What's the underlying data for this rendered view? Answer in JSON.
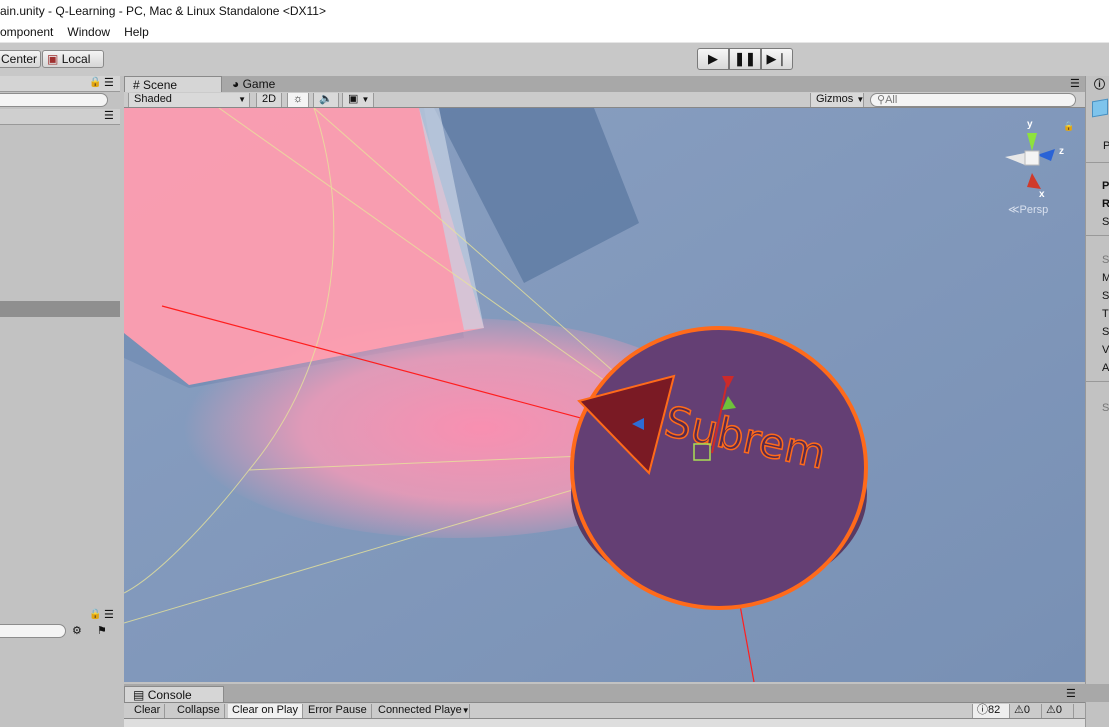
{
  "window": {
    "title": "ain.unity - Q-Learning - PC, Mac & Linux Standalone <DX11>"
  },
  "menu": [
    "omponent",
    "Window",
    "Help"
  ],
  "toolbar": {
    "pivot_label": "Center",
    "space_label": "Local",
    "play_icons": [
      "play-icon",
      "pause-icon",
      "step-icon"
    ]
  },
  "scene": {
    "tabs": [
      "Scene",
      "Game"
    ],
    "shading": "Shaded",
    "mode_2d": "2D",
    "gizmos": "Gizmos",
    "search_placeholder": "All",
    "persp_label": "Persp",
    "axis_y": "y",
    "axis_z": "z",
    "axis_x": "x",
    "object_text": "Subrem"
  },
  "console": {
    "tab": "Console",
    "buttons": [
      "Clear",
      "Collapse",
      "Clear on Play",
      "Error Pause",
      "Connected Playe"
    ],
    "counts": {
      "logs": "82",
      "warnings": "0",
      "errors": "0"
    }
  },
  "inspector": {
    "letters": [
      "P",
      "R",
      "S",
      "S",
      "M",
      "S",
      "T",
      "S",
      "V",
      "A",
      "S"
    ]
  }
}
